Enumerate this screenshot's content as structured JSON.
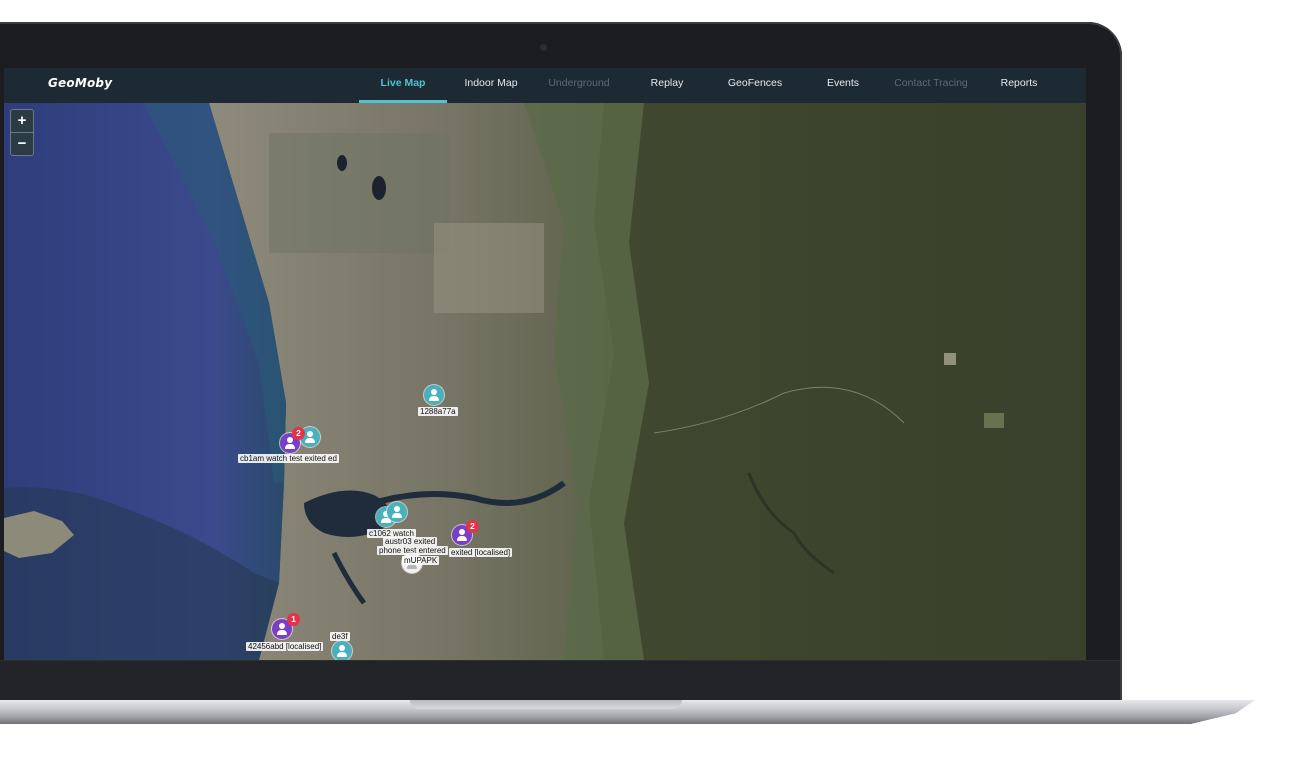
{
  "app": {
    "logo": "GeoMoby"
  },
  "nav": {
    "items": [
      {
        "label": "Live Map",
        "state": "active"
      },
      {
        "label": "Indoor Map",
        "state": "normal"
      },
      {
        "label": "Underground",
        "state": "disabled"
      },
      {
        "label": "Replay",
        "state": "normal"
      },
      {
        "label": "GeoFences",
        "state": "normal"
      },
      {
        "label": "Events",
        "state": "normal"
      },
      {
        "label": "Contact Tracing",
        "state": "disabled"
      },
      {
        "label": "Reports",
        "state": "normal"
      }
    ]
  },
  "map": {
    "zoom_in_label": "+",
    "zoom_out_label": "−",
    "markers": {
      "m1": {
        "label": "1288a77a"
      },
      "m2": {
        "label": "cb1am watch test exited ed",
        "badge": "2"
      },
      "m3": {
        "label": "c1062 watch"
      },
      "m4": {
        "label": "austr03 exited"
      },
      "m5": {
        "label": "phone test entered"
      },
      "m6": {
        "label": "exited [localised]",
        "badge": "2"
      },
      "m7": {
        "label": "mUPAPK"
      },
      "m8": {
        "label": "de3f"
      },
      "m9": {
        "label": "42456abd [localised]",
        "badge": "1"
      }
    }
  },
  "colors": {
    "accent": "#4fc3cf",
    "topbar": "#1e2a33",
    "marker_teal": "#4ab0bd",
    "marker_purple": "#7a3fc6",
    "badge_red": "#e2334a"
  }
}
